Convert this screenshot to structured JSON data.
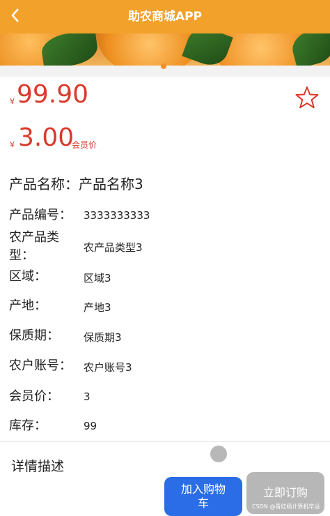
{
  "header": {
    "title": "助农商城APP",
    "back_icon": "chevron-left-icon"
  },
  "carousel": {
    "image": "orange-fruit-banner",
    "indicator_active": 1
  },
  "product": {
    "currency_symbol": "¥",
    "price": "99.90",
    "member_price": "3.00",
    "member_price_label": "会员价",
    "favorite_icon": "star-outline-icon",
    "name_label": "产品名称：",
    "name_value": "产品名称3"
  },
  "details": [
    {
      "label": "产品编号：",
      "value": "3333333333"
    },
    {
      "label_lines": [
        "农产品类",
        "型："
      ],
      "value": "农产品类型3"
    },
    {
      "label": "区域：",
      "value": "区域3"
    },
    {
      "label": "产地：",
      "value": "产地3"
    },
    {
      "label": "保质期：",
      "value": "保质期3"
    },
    {
      "label": "农户账号：",
      "value": "农户账号3"
    },
    {
      "label": "会员价：",
      "value": "3"
    },
    {
      "label": "库存：",
      "value": "99"
    }
  ],
  "description": {
    "title": "详情描述"
  },
  "actions": {
    "add_to_cart_lines": [
      "加入购物",
      "车"
    ],
    "buy_now": "立即订购"
  },
  "watermark": "CSDN @青红杨计算机毕设",
  "colors": {
    "header": "#f2a12a",
    "price": "#d93a2b",
    "cart_button": "#2b6de6",
    "buy_button": "#b7b7b7"
  }
}
